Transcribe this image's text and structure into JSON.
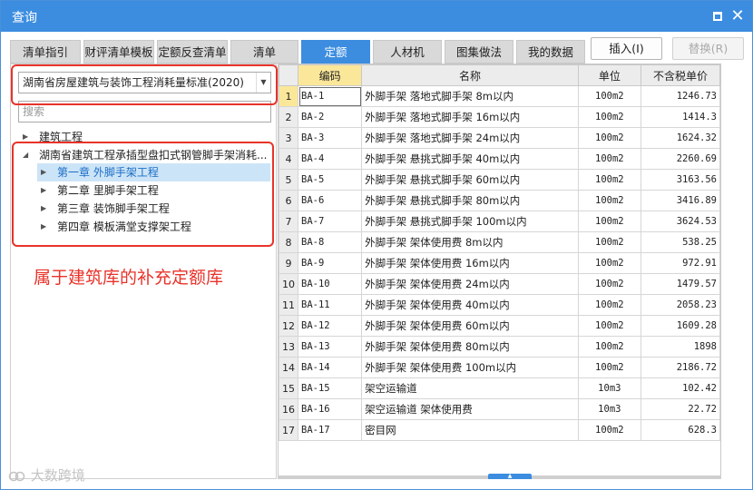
{
  "window": {
    "title": "查询",
    "max_icon": "maximize-icon",
    "close_glyph": "✕"
  },
  "tabs": [
    {
      "label": "清单指引",
      "active": false
    },
    {
      "label": "财评清单模板",
      "active": false
    },
    {
      "label": "定额反查清单",
      "active": false
    },
    {
      "label": "清单",
      "active": false
    },
    {
      "label": "定额",
      "active": true
    },
    {
      "label": "人材机",
      "active": false
    },
    {
      "label": "图集做法",
      "active": false
    },
    {
      "label": "我的数据",
      "active": false
    }
  ],
  "toolbar": {
    "insert_label": "插入(I)",
    "replace_label": "替换(R)"
  },
  "library_select": {
    "value": "湖南省房屋建筑与装饰工程消耗量标准(2020)"
  },
  "search": {
    "placeholder": "搜索"
  },
  "tree": [
    {
      "label": "建筑工程",
      "level": 0,
      "expanded": false
    },
    {
      "label": "湖南省建筑工程承插型盘扣式钢管脚手架消耗...",
      "level": 0,
      "expanded": true
    },
    {
      "label": "第一章 外脚手架工程",
      "level": 1,
      "selected": true
    },
    {
      "label": "第二章 里脚手架工程",
      "level": 1
    },
    {
      "label": "第三章 装饰脚手架工程",
      "level": 1
    },
    {
      "label": "第四章 模板满堂支撑架工程",
      "level": 1
    }
  ],
  "annotation": "属于建筑库的补充定额库",
  "table": {
    "columns": [
      "编码",
      "名称",
      "单位",
      "不含税单价"
    ],
    "rows": [
      {
        "no": "1",
        "code": "BA-1",
        "name": "外脚手架 落地式脚手架 8m以内",
        "unit": "100m2",
        "price": "1246.73"
      },
      {
        "no": "2",
        "code": "BA-2",
        "name": "外脚手架 落地式脚手架 16m以内",
        "unit": "100m2",
        "price": "1414.3"
      },
      {
        "no": "3",
        "code": "BA-3",
        "name": "外脚手架 落地式脚手架 24m以内",
        "unit": "100m2",
        "price": "1624.32"
      },
      {
        "no": "4",
        "code": "BA-4",
        "name": "外脚手架 悬挑式脚手架 40m以内",
        "unit": "100m2",
        "price": "2260.69"
      },
      {
        "no": "5",
        "code": "BA-5",
        "name": "外脚手架 悬挑式脚手架 60m以内",
        "unit": "100m2",
        "price": "3163.56"
      },
      {
        "no": "6",
        "code": "BA-6",
        "name": "外脚手架 悬挑式脚手架 80m以内",
        "unit": "100m2",
        "price": "3416.89"
      },
      {
        "no": "7",
        "code": "BA-7",
        "name": "外脚手架 悬挑式脚手架 100m以内",
        "unit": "100m2",
        "price": "3624.53"
      },
      {
        "no": "8",
        "code": "BA-8",
        "name": "外脚手架 架体使用费 8m以内",
        "unit": "100m2",
        "price": "538.25"
      },
      {
        "no": "9",
        "code": "BA-9",
        "name": "外脚手架 架体使用费 16m以内",
        "unit": "100m2",
        "price": "972.91"
      },
      {
        "no": "10",
        "code": "BA-10",
        "name": "外脚手架 架体使用费 24m以内",
        "unit": "100m2",
        "price": "1479.57"
      },
      {
        "no": "11",
        "code": "BA-11",
        "name": "外脚手架 架体使用费 40m以内",
        "unit": "100m2",
        "price": "2058.23"
      },
      {
        "no": "12",
        "code": "BA-12",
        "name": "外脚手架 架体使用费 60m以内",
        "unit": "100m2",
        "price": "1609.28"
      },
      {
        "no": "13",
        "code": "BA-13",
        "name": "外脚手架 架体使用费 80m以内",
        "unit": "100m2",
        "price": "1898"
      },
      {
        "no": "14",
        "code": "BA-14",
        "name": "外脚手架 架体使用费 100m以内",
        "unit": "100m2",
        "price": "2186.72"
      },
      {
        "no": "15",
        "code": "BA-15",
        "name": "架空运输道",
        "unit": "10m3",
        "price": "102.42"
      },
      {
        "no": "16",
        "code": "BA-16",
        "name": "架空运输道 架体使用费",
        "unit": "10m3",
        "price": "22.72"
      },
      {
        "no": "17",
        "code": "BA-17",
        "name": "密目网",
        "unit": "100m2",
        "price": "628.3"
      }
    ]
  },
  "watermark": "大数跨境",
  "colors": {
    "accent": "#3c8de0",
    "annotation_red": "#e8332a",
    "selected_row": "#cce4f7",
    "header_highlight": "#fbe79a"
  }
}
